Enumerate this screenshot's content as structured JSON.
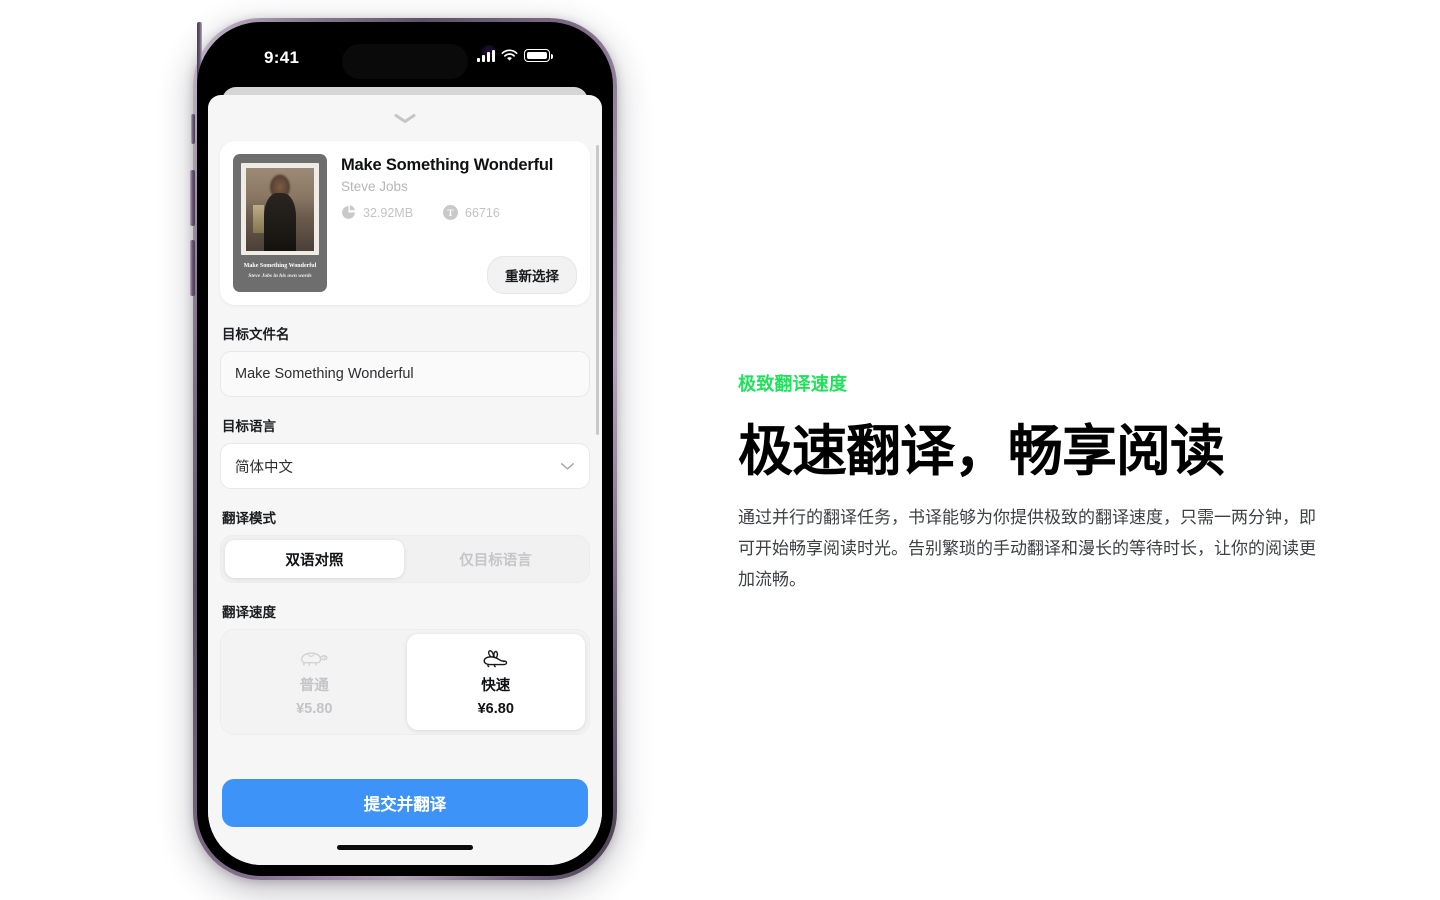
{
  "phone": {
    "status_bar": {
      "time": "9:41",
      "signal_icon": "cellular-bars-icon",
      "wifi_icon": "wifi-icon",
      "battery_icon": "battery-icon"
    },
    "sheet": {
      "grabber_icon": "chevron-down-icon",
      "book_card": {
        "title": "Make Something Wonderful",
        "author": "Steve Jobs",
        "cover_caption_title": "Make Something Wonderful",
        "cover_caption_sub": "Steve Jobs in his own words",
        "file_size": "32.92MB",
        "file_size_icon": "pie-chart-icon",
        "token_count": "66716",
        "token_icon": "token-t-icon",
        "reselect_label": "重新选择"
      },
      "filename_field": {
        "label": "目标文件名",
        "value": "Make Something Wonderful"
      },
      "language_field": {
        "label": "目标语言",
        "value": "简体中文",
        "chevron_icon": "chevron-down-icon"
      },
      "mode_field": {
        "label": "翻译模式",
        "options": [
          {
            "label": "双语对照",
            "selected": true
          },
          {
            "label": "仅目标语言",
            "selected": false
          }
        ]
      },
      "speed_field": {
        "label": "翻译速度",
        "options": [
          {
            "name": "普通",
            "price": "¥5.80",
            "icon": "turtle-icon",
            "selected": false
          },
          {
            "name": "快速",
            "price": "¥6.80",
            "icon": "rabbit-icon",
            "selected": true
          }
        ]
      },
      "submit_label": "提交并翻译"
    }
  },
  "marketing": {
    "eyebrow": "极致翻译速度",
    "headline": "极速翻译，畅享阅读",
    "paragraph": "通过并行的翻译任务，书译能够为你提供极致的翻译速度，只需一两分钟，即可开始畅享阅读时光。告别繁琐的手动翻译和漫长的等待时长，让你的阅读更加流畅。"
  },
  "colors": {
    "accent_green": "#22e05c",
    "primary_blue": "#3d93f7",
    "sheet_bg": "#f6f6f7"
  }
}
